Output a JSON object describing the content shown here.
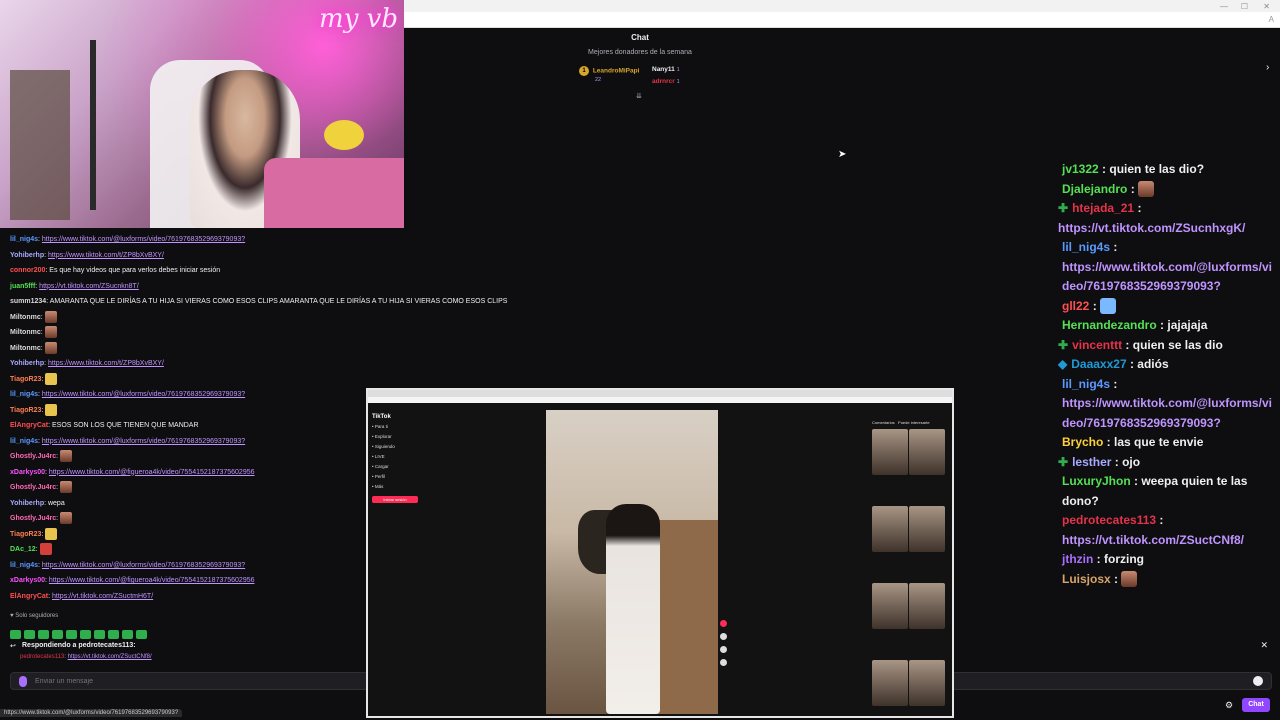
{
  "webcam": {
    "neon_text": "my vb"
  },
  "chat_header": "Chat",
  "donors": {
    "title": "Mejores donadores de la semana",
    "first": {
      "rank": "1",
      "name": "LeandroMiPapi",
      "amount": "22"
    },
    "second": {
      "name": "Nany11",
      "amount": "1"
    },
    "third": {
      "name": "adrnrcr",
      "amount": "1"
    }
  },
  "chat_log": [
    {
      "user": "lil_nig4s",
      "color": "#5b99ff",
      "text": "",
      "link": "https://www.tiktok.com/@luxforms/video/7619768352969379093?"
    },
    {
      "user": "Yohiberhp",
      "color": "#a9a9ff",
      "text": "",
      "link": "https://www.tiktok.com/t/ZP8bXvBXY/"
    },
    {
      "user": "connor200",
      "color": "#ff4f4f",
      "text": "Es que hay videos que para verlos debes iniciar sesión",
      "link": ""
    },
    {
      "user": "juan5fff",
      "color": "#54e054",
      "text": "",
      "link": "https://vt.tiktok.com/ZSucnkn8T/"
    },
    {
      "user": "summ1234",
      "color": "#d9d9d9",
      "text": "AMARANTA QUE LE DIRÍAS A TU HIJA SI VIERAS COMO ESOS CLIPS AMARANTA QUE LE DIRÍAS A TU HIJA SI VIERAS COMO ESOS CLIPS",
      "link": ""
    },
    {
      "user": "Miltonmc",
      "color": "#d9d9d9",
      "text": "",
      "link": "",
      "emote": "face"
    },
    {
      "user": "Miltonmc",
      "color": "#d9d9d9",
      "text": "",
      "link": "",
      "emote": "face"
    },
    {
      "user": "Miltonmc",
      "color": "#d9d9d9",
      "text": "",
      "link": "",
      "emote": "face"
    },
    {
      "user": "Yohiberhp",
      "color": "#a9a9ff",
      "text": "",
      "link": "https://www.tiktok.com/t/ZP8bXvBXY/"
    },
    {
      "user": "TiagoR23",
      "color": "#ff7f50",
      "text": "",
      "link": "",
      "emote": "cat"
    },
    {
      "user": "lil_nig4s",
      "color": "#5b99ff",
      "text": "",
      "link": "https://www.tiktok.com/@luxforms/video/7619768352969379093?"
    },
    {
      "user": "TiagoR23",
      "color": "#ff7f50",
      "text": "",
      "link": "",
      "emote": "cat"
    },
    {
      "user": "ElAngryCat",
      "color": "#ff4f4f",
      "text": "ESOS SON LOS QUE TIENEN QUE MANDAR",
      "link": ""
    },
    {
      "user": "lil_nig4s",
      "color": "#5b99ff",
      "text": "",
      "link": "https://www.tiktok.com/@luxforms/video/7619768352969379093?"
    },
    {
      "user": "Ghostly.Ju4rc",
      "color": "#ff69b4",
      "text": "",
      "link": "",
      "emote": "face"
    },
    {
      "user": "xDarkys00",
      "color": "#ff4fff",
      "text": "",
      "link": "https://www.tiktok.com/@figueroa4k/video/7554152187375602956"
    },
    {
      "user": "Ghostly.Ju4rc",
      "color": "#ff69b4",
      "text": "",
      "link": "",
      "emote": "face"
    },
    {
      "user": "Yohiberhp",
      "color": "#a9a9ff",
      "text": "wepa",
      "link": ""
    },
    {
      "user": "Ghostly.Ju4rc",
      "color": "#ff69b4",
      "text": "",
      "link": "",
      "emote": "face"
    },
    {
      "user": "TiagoR23",
      "color": "#ff7f50",
      "text": "",
      "link": "",
      "emote": "cat"
    },
    {
      "user": "DAc_12",
      "color": "#54e054",
      "text": "",
      "link": "",
      "emote": "red"
    },
    {
      "user": "lil_nig4s",
      "color": "#5b99ff",
      "text": "",
      "link": "https://www.tiktok.com/@luxforms/video/7619768352969379093?"
    },
    {
      "user": "xDarkys00",
      "color": "#ff4fff",
      "text": "",
      "link": "https://www.tiktok.com/@figueroa4k/video/7554152187375602956"
    },
    {
      "user": "ElAngryCat",
      "color": "#ff4f4f",
      "text": "",
      "link": "https://vt.tiktok.com/ZSuctmH6T/"
    }
  ],
  "sub_only_label": "Solo seguidores",
  "reply": {
    "title": "Respondiendo a pedrotecates113:",
    "quote_user": "pedrotecates113",
    "quote_link": "https://vt.tiktok.com/ZSuctCNf8/"
  },
  "send_placeholder": "Enviar un mensaje",
  "status_url": "https://www.tiktok.com/@luxforms/video/7619768352969379093?",
  "chat_button": "Chat",
  "right_chat": [
    {
      "user": "jv1322",
      "color": "#54e054",
      "text": "quien te las dio?",
      "badge": ""
    },
    {
      "user": "Djalejandro",
      "color": "#54e054",
      "text": "",
      "badge": "",
      "emote": true
    },
    {
      "user": "htejada_21",
      "color": "#e4334b",
      "text": "",
      "link": "https://vt.tiktok.com/ZSucnhxgK/",
      "badge": "mod"
    },
    {
      "user": "lil_nig4s",
      "color": "#5b99ff",
      "text": "",
      "link": "https://www.tiktok.com/@luxforms/video/7619768352969379093?",
      "badge": ""
    },
    {
      "user": "gll22",
      "color": "#ff4f4f",
      "text": "",
      "badge": "",
      "emote_blue": true
    },
    {
      "user": "Hernandezandro",
      "color": "#54e054",
      "text": "jajajaja",
      "badge": ""
    },
    {
      "user": "vincenttt",
      "color": "#e4334b",
      "text": "quien se las dio",
      "badge": "mod"
    },
    {
      "user": "Daaaxx27",
      "color": "#1e9bd7",
      "text": "adiós",
      "badge": "vip"
    },
    {
      "user": "lil_nig4s",
      "color": "#5b99ff",
      "text": "",
      "link": "https://www.tiktok.com/@luxforms/video/7619768352969379093?",
      "badge": ""
    },
    {
      "user": "Brycho",
      "color": "#ffd23c",
      "text": "las que te envie",
      "badge": ""
    },
    {
      "user": "lesther",
      "color": "#a9a9ff",
      "text": "ojo",
      "badge": "mod"
    },
    {
      "user": "LuxuryJhon",
      "color": "#54e054",
      "text": "weepa quien te las dono?",
      "badge": ""
    },
    {
      "user": "pedrotecates113",
      "color": "#e4334b",
      "text": "",
      "link": "https://vt.tiktok.com/ZSuctCNf8/",
      "badge": ""
    },
    {
      "user": "jthzin",
      "color": "#a970ff",
      "text": "forzing",
      "badge": ""
    },
    {
      "user": "Luisjosx",
      "color": "#d9a46a",
      "text": "",
      "badge": "",
      "emote": true
    }
  ],
  "tiktok": {
    "logo": "TikTok",
    "nav": [
      "Para ti",
      "Explorar",
      "Siguiendo",
      "LIVE",
      "Cargar",
      "Perfil",
      "Más"
    ],
    "login_button": "Iniciar sesión",
    "related_header": "Comentarios",
    "related_tab": "Puede interesarte"
  }
}
